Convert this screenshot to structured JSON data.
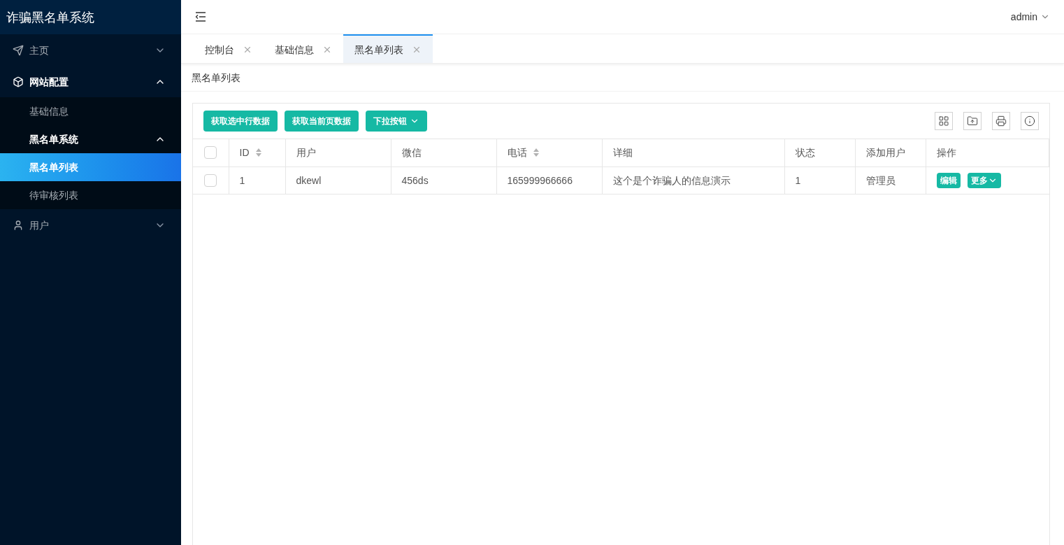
{
  "sidebar": {
    "title": "诈骗黑名单系统",
    "items": [
      {
        "label": "主页",
        "selected": false,
        "expanded": false
      },
      {
        "label": "网站配置",
        "selected": false,
        "expanded": true,
        "children": [
          {
            "label": "基础信息",
            "selected": false
          },
          {
            "label": "黑名单系统",
            "selected": false,
            "expanded": true,
            "children": [
              {
                "label": "黑名单列表",
                "selected": true
              },
              {
                "label": "待审核列表",
                "selected": false
              }
            ]
          }
        ]
      },
      {
        "label": "用户",
        "selected": false,
        "expanded": false
      }
    ]
  },
  "header": {
    "user": "admin"
  },
  "tabs": [
    {
      "label": "控制台",
      "selected": false
    },
    {
      "label": "基础信息",
      "selected": false
    },
    {
      "label": "黑名单列表",
      "selected": true
    }
  ],
  "breadcrumb": "黑名单列表",
  "toolbar": {
    "buttons": [
      {
        "label": "获取选中行数据",
        "kind": "plain"
      },
      {
        "label": "获取当前页数据",
        "kind": "plain"
      },
      {
        "label": "下拉按钮",
        "kind": "dropdown"
      }
    ]
  },
  "table": {
    "all_checked": false,
    "columns": [
      {
        "label": "ID",
        "sortable": true
      },
      {
        "label": "用户",
        "sortable": false
      },
      {
        "label": "微信",
        "sortable": false
      },
      {
        "label": "电话",
        "sortable": true
      },
      {
        "label": "详细",
        "sortable": false
      },
      {
        "label": "状态",
        "sortable": false
      },
      {
        "label": "添加用户",
        "sortable": false
      },
      {
        "label": "操作",
        "sortable": false
      }
    ],
    "rows": [
      {
        "checked": false,
        "cells": [
          "1",
          "dkewl",
          "456ds",
          "165999966666",
          "这个是个诈骗人的信息演示",
          "1",
          "管理员"
        ],
        "actions": [
          {
            "label": "编辑",
            "kind": "plain"
          },
          {
            "label": "更多",
            "kind": "dropdown"
          }
        ]
      }
    ]
  }
}
